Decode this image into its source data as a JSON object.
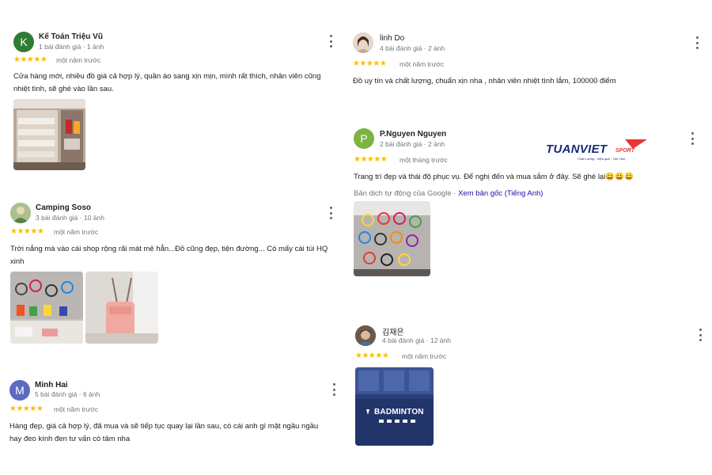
{
  "reviews": [
    {
      "name": "Kế Toán Triệu Vũ",
      "avatar_letter": "K",
      "avatar_color": "#2e7d32",
      "meta": "1 bài đánh giá · 1 ảnh",
      "stars": "★★★★★",
      "date": "một năm trước",
      "text": "Cửa hàng mới, nhiều đồ giá cả hợp lý, quần áo sang xịn mịn, mình rất thích, nhân viên cũng nhiệt tình, sẽ ghé vào lần sau."
    },
    {
      "name": "Camping Soso",
      "meta": "3 bài đánh giá · 10 ảnh",
      "stars": "★★★★★",
      "date": "một năm trước",
      "text": "Trời nắng mà vào cái shop rộng rãi mát mẻ hẳn...Đồ cũng đẹp, tiện đường... Có mấy cái túi HQ xinh"
    },
    {
      "name": "Minh Hai",
      "avatar_letter": "M",
      "avatar_color": "#5c6bc0",
      "meta": "5 bài đánh giá · 6 ảnh",
      "stars": "★★★★★",
      "date": "một năm trước",
      "text": "Hàng đẹp, giá cả hợp lý, đã mua và sẽ tiếp tục quay lại lần sau, có cái anh gì mặt ngầu ngầu hay đeo kính đen tư vấn có tâm nha"
    },
    {
      "name": "linh Do",
      "meta": "4 bài đánh giá · 2 ảnh",
      "stars": "★★★★★",
      "date": "một năm trước",
      "text": "Đồ uy tín và chất lượng, chuẩn xịn nha , nhân viên nhiệt tình lắm, 100000 điểm"
    },
    {
      "name": "P.Nguyen Nguyen",
      "avatar_letter": "P",
      "avatar_color": "#7cb342",
      "meta": "2 bài đánh giá · 2 ảnh",
      "stars": "★★★★★",
      "date": "một tháng trước",
      "text": "Trang trí đẹp và thái độ phục vụ. Để nghị đến và mua sắm ở đây. Sẽ ghé lại😀😀😀",
      "translation_note": "Bản dịch tự động của Google",
      "translation_link": "Xem bản gốc (Tiếng Anh)"
    },
    {
      "name": "김재은",
      "meta": "4 bài đánh giá · 12 ảnh",
      "stars": "★★★★★",
      "date": "một năm trước",
      "photo_sign": "BADMINTON"
    }
  ],
  "brand": {
    "name_main": "TUANVIET",
    "name_sub": "SPORT",
    "tagline": "Chất Lượng - Hiệu quả - Tận Tâm",
    "color": "#1a2a7a",
    "accent": "#e53935"
  },
  "colors": {
    "star": "#fbbc04",
    "link": "#1a0dab",
    "meta": "#70757a"
  }
}
